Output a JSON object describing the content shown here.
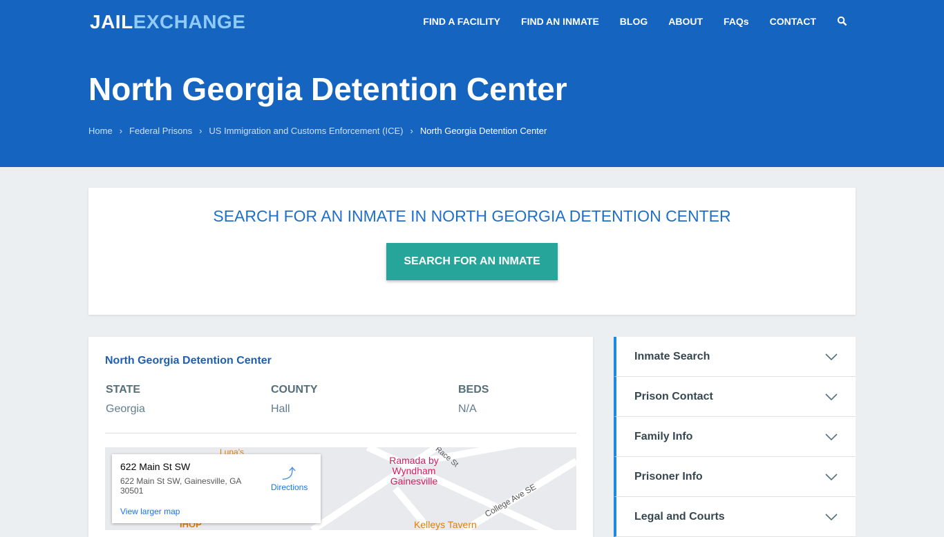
{
  "header": {
    "logo_a": "JAIL",
    "logo_b": "EXCHANGE",
    "nav": [
      "FIND A FACILITY",
      "FIND AN INMATE",
      "BLOG",
      "ABOUT",
      "FAQs",
      "CONTACT"
    ]
  },
  "hero": {
    "title": "North Georgia Detention Center",
    "breadcrumb": [
      "Home",
      "Federal Prisons",
      "US Immigration and Customs Enforcement (ICE)",
      "North Georgia Detention Center"
    ]
  },
  "search": {
    "heading": "SEARCH FOR AN INMATE IN NORTH GEORGIA DETENTION CENTER",
    "button": "SEARCH FOR AN INMATE"
  },
  "facility": {
    "name": "North Georgia Detention Center",
    "fields": [
      {
        "label": "STATE",
        "value": "Georgia"
      },
      {
        "label": "COUNTY",
        "value": "Hall"
      },
      {
        "label": "BEDS",
        "value": "N/A"
      }
    ]
  },
  "map": {
    "title": "622 Main St SW",
    "address": "622 Main St SW, Gainesville, GA 30501",
    "directions": "Directions",
    "larger": "View larger map",
    "places": [
      "Ramada by Wyndham Gainesville",
      "Kelleys Tavern",
      "College Ave SE",
      "Luna's",
      "IHOP",
      "Race St"
    ]
  },
  "sidebar": [
    "Inmate Search",
    "Prison Contact",
    "Family Info",
    "Prisoner Info",
    "Legal and Courts"
  ]
}
